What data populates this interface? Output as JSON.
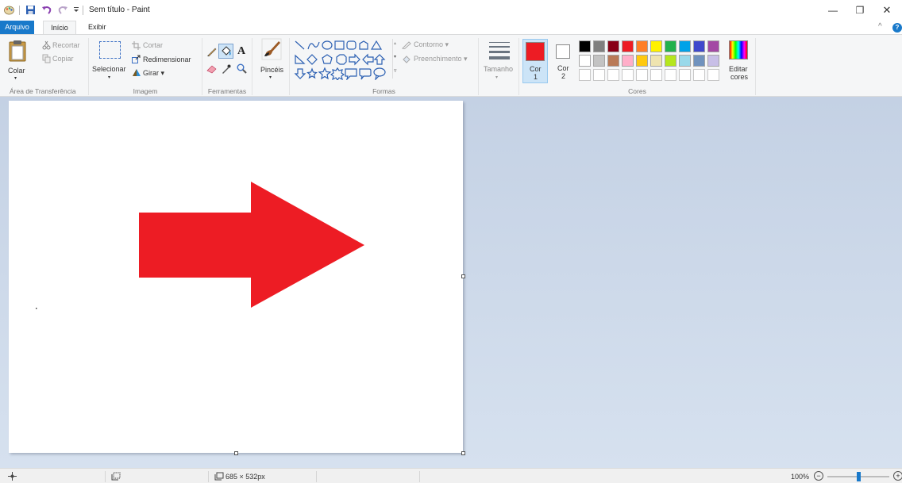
{
  "window": {
    "title": "Sem título - Paint",
    "controls": {
      "minimize": "—",
      "restore": "❐",
      "close": "✕"
    }
  },
  "menu": {
    "file": "Arquivo",
    "home": "Início",
    "view": "Exibir",
    "collapse": "^",
    "help": "?"
  },
  "ribbon": {
    "clipboard": {
      "paste": "Colar",
      "cut": "Recortar",
      "copy": "Copiar",
      "label": "Área de Transferência"
    },
    "image": {
      "select": "Selecionar",
      "crop": "Cortar",
      "resize": "Redimensionar",
      "rotate": "Girar",
      "label": "Imagem"
    },
    "tools": {
      "text_icon": "A",
      "label": "Ferramentas"
    },
    "brushes": {
      "label": "Pincéis"
    },
    "shapes": {
      "outline": "Contorno",
      "fill": "Preenchimento",
      "label": "Formas"
    },
    "size": {
      "label": "Tamanho"
    },
    "colors": {
      "color1_line1": "Cor",
      "color1_line2": "1",
      "color2_line1": "Cor",
      "color2_line2": "2",
      "edit_line1": "Editar",
      "edit_line2": "cores",
      "label": "Cores",
      "color1": "#ed1c24",
      "color2": "#ffffff",
      "palette_row1": [
        "#000000",
        "#7f7f7f",
        "#880015",
        "#ed1c24",
        "#ff7f27",
        "#fff200",
        "#22b14c",
        "#00a2e8",
        "#3f48cc",
        "#a349a4"
      ],
      "palette_row2": [
        "#ffffff",
        "#c3c3c3",
        "#b97a57",
        "#ffaec9",
        "#ffc90e",
        "#efe4b0",
        "#b5e61d",
        "#99d9ea",
        "#7092be",
        "#c8bfe7"
      ],
      "palette_row3": [
        "",
        "",
        "",
        "",
        "",
        "",
        "",
        "",
        "",
        ""
      ]
    }
  },
  "canvas": {
    "arrow_color": "#ed1c24"
  },
  "status": {
    "image_size": "685 × 532px",
    "zoom": "100%",
    "zoom_out": "−",
    "zoom_in": "+"
  }
}
